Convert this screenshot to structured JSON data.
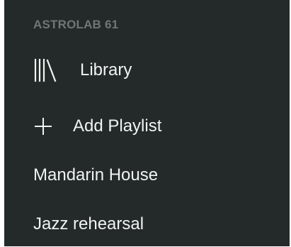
{
  "sidebar": {
    "section_title": "ASTROLAB 61",
    "library": {
      "label": "Library",
      "icon": "library-icon"
    },
    "add_playlist": {
      "label": "Add Playlist",
      "icon": "plus-icon"
    },
    "playlists": [
      {
        "label": "Mandarin House"
      },
      {
        "label": "Jazz rehearsal"
      }
    ]
  },
  "colors": {
    "panel_background": "#232a29",
    "section_title": "#6f7776",
    "text_primary": "#f0f3f2"
  }
}
